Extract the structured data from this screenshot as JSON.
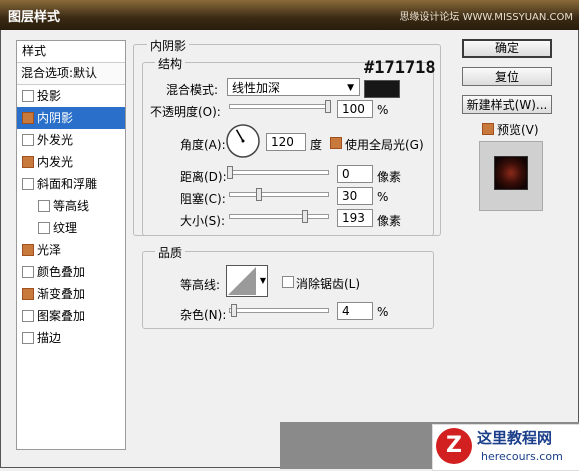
{
  "window": {
    "title": "图层样式",
    "watermark": "思缘设计论坛 WWW.MISSYUAN.COM"
  },
  "styles_list": {
    "header": "样式",
    "blend_options": "混合选项:默认",
    "items": [
      {
        "label": "投影",
        "checked": false,
        "selected": false,
        "sub": false
      },
      {
        "label": "内阴影",
        "checked": true,
        "selected": true,
        "sub": false
      },
      {
        "label": "外发光",
        "checked": false,
        "selected": false,
        "sub": false
      },
      {
        "label": "内发光",
        "checked": true,
        "selected": false,
        "sub": false
      },
      {
        "label": "斜面和浮雕",
        "checked": false,
        "selected": false,
        "sub": false
      },
      {
        "label": "等高线",
        "checked": false,
        "selected": false,
        "sub": true
      },
      {
        "label": "纹理",
        "checked": false,
        "selected": false,
        "sub": true
      },
      {
        "label": "光泽",
        "checked": true,
        "selected": false,
        "sub": false
      },
      {
        "label": "颜色叠加",
        "checked": false,
        "selected": false,
        "sub": false
      },
      {
        "label": "渐变叠加",
        "checked": true,
        "selected": false,
        "sub": false
      },
      {
        "label": "图案叠加",
        "checked": false,
        "selected": false,
        "sub": false
      },
      {
        "label": "描边",
        "checked": false,
        "selected": false,
        "sub": false
      }
    ]
  },
  "inner_shadow": {
    "title": "内阴影",
    "structure": {
      "title": "结构",
      "blend_mode_label": "混合模式:",
      "blend_mode_value": "线性加深",
      "color_hex_label": "#171718",
      "color": "#171718",
      "opacity": {
        "label": "不透明度(O):",
        "value": "100",
        "unit": "%",
        "level": 1.0
      },
      "angle": {
        "label": "角度(A):",
        "value": "120",
        "unit": "度",
        "degrees": 120
      },
      "global_light": {
        "label": "使用全局光(G)",
        "checked": true
      },
      "distance": {
        "label": "距离(D):",
        "value": "0",
        "unit": "像素",
        "level": 0.0
      },
      "choke": {
        "label": "阻塞(C):",
        "value": "30",
        "unit": "%",
        "level": 0.3
      },
      "size": {
        "label": "大小(S):",
        "value": "193",
        "unit": "像素",
        "level": 0.77
      }
    },
    "quality": {
      "title": "品质",
      "contour_label": "等高线:",
      "anti_alias": {
        "label": "消除锯齿(L)",
        "checked": false
      },
      "noise": {
        "label": "杂色(N):",
        "value": "4",
        "unit": "%",
        "level": 0.04
      }
    }
  },
  "buttons": {
    "ok": "确定",
    "reset": "复位",
    "new_style": "新建样式(W)...",
    "preview_label": "预览(V)",
    "preview_checked": true
  },
  "logo": {
    "mark": "Z",
    "name": "这里教程网",
    "url": "herecours.com"
  }
}
